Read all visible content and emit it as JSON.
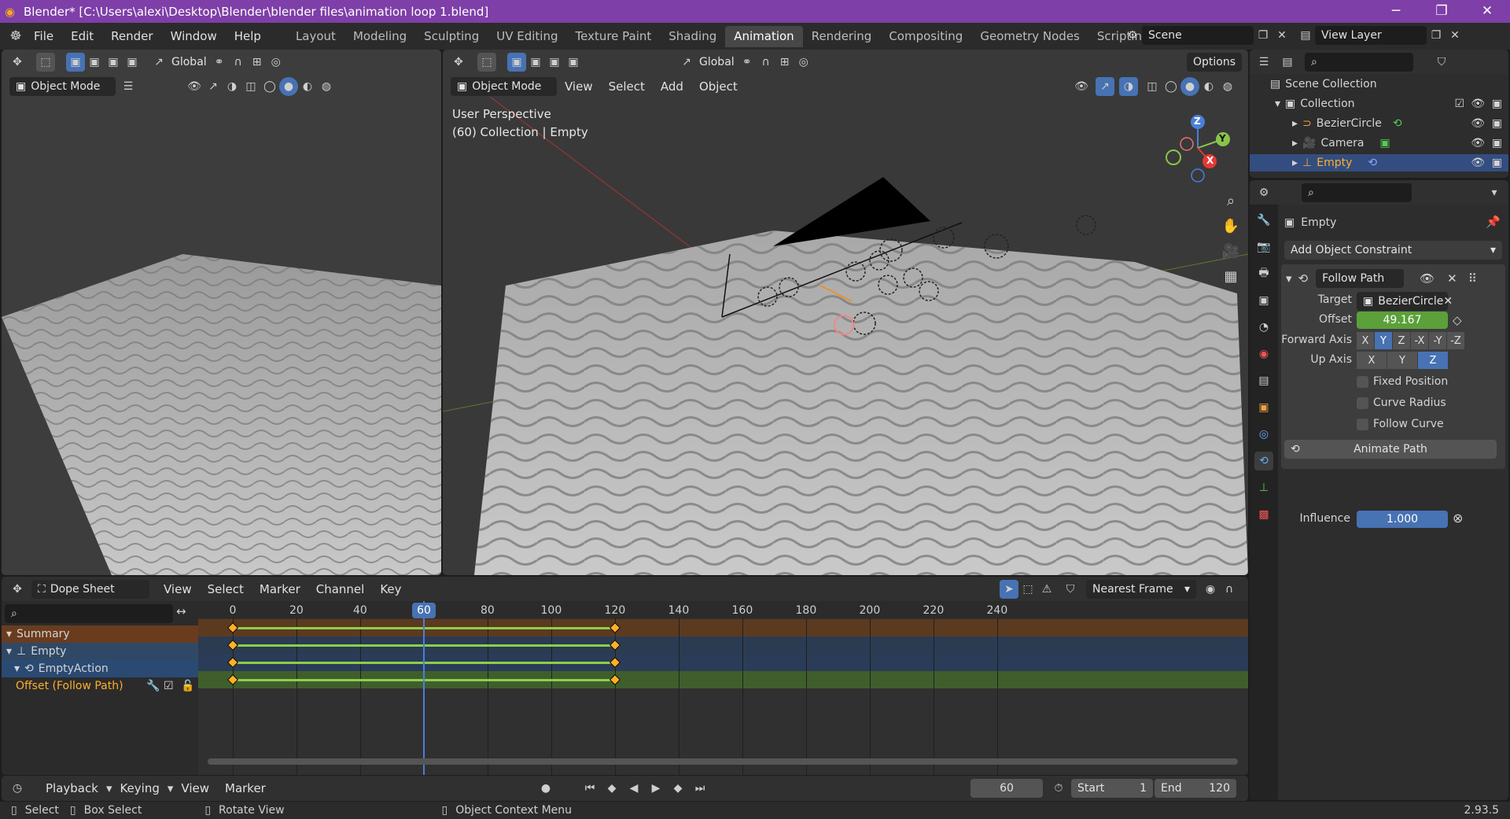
{
  "window": {
    "title": "Blender* [C:\\Users\\alexi\\Desktop\\Blender\\blender files\\animation loop 1.blend]",
    "minimize": "─",
    "maximize": "❐",
    "close": "✕"
  },
  "menu": [
    "File",
    "Edit",
    "Render",
    "Window",
    "Help"
  ],
  "workspaces": [
    "Layout",
    "Modeling",
    "Sculpting",
    "UV Editing",
    "Texture Paint",
    "Shading",
    "Animation",
    "Rendering",
    "Compositing",
    "Geometry Nodes",
    "Scripting"
  ],
  "workspace_add": "+",
  "scene_name": "Scene",
  "view_layer": "View Layer",
  "left_view": {
    "orientation": "Global",
    "mode": "Object Mode"
  },
  "main_view": {
    "orientation": "Global",
    "options": "Options",
    "mode": "Object Mode",
    "menus": [
      "View",
      "Select",
      "Add",
      "Object"
    ],
    "overlay_title": "User Perspective",
    "overlay_sub": "(60) Collection | Empty",
    "gizmo": {
      "z": "Z",
      "y": "Y",
      "x": "X"
    }
  },
  "outliner": {
    "scene_collection": "Scene Collection",
    "collection": "Collection",
    "items": [
      {
        "name": "BezierCircle"
      },
      {
        "name": "Camera"
      },
      {
        "name": "Empty"
      }
    ]
  },
  "properties": {
    "object_name": "Empty",
    "add_constraint": "Add Object Constraint",
    "constraint_name": "Follow Path",
    "target_label": "Target",
    "target_value": "BezierCircle",
    "offset_label": "Offset",
    "offset_value": "49.167",
    "forward_label": "Forward Axis",
    "forward_axes": [
      "X",
      "Y",
      "Z",
      "-X",
      "-Y",
      "-Z"
    ],
    "forward_selected": "Y",
    "up_label": "Up Axis",
    "up_axes": [
      "X",
      "Y",
      "Z"
    ],
    "up_selected": "Z",
    "fixed_position": "Fixed Position",
    "curve_radius": "Curve Radius",
    "follow_curve": "Follow Curve",
    "animate_path": "Animate Path",
    "influence_label": "Influence",
    "influence_value": "1.000"
  },
  "dopesheet": {
    "editor": "Dope Sheet",
    "menus": [
      "View",
      "Select",
      "Marker",
      "Channel",
      "Key"
    ],
    "snap": "Nearest Frame",
    "current_frame": "60",
    "ticks": [
      "0",
      "20",
      "40",
      "60",
      "80",
      "100",
      "120",
      "140",
      "160",
      "180",
      "200",
      "220",
      "240"
    ],
    "channels": [
      {
        "label": "Summary",
        "kind": "summary"
      },
      {
        "label": "Empty",
        "kind": "object"
      },
      {
        "label": "EmptyAction",
        "kind": "action"
      },
      {
        "label": "Offset (Follow Path)",
        "kind": "fcurve"
      }
    ],
    "keyframes": [
      0,
      120
    ]
  },
  "timeline": {
    "menus": [
      "Playback",
      "Keying",
      "View",
      "Marker"
    ],
    "frame": "60",
    "start_label": "Start",
    "start_value": "1",
    "end_label": "End",
    "end_value": "120"
  },
  "statusbar": {
    "select": "Select",
    "box_select": "Box Select",
    "rotate": "Rotate View",
    "context": "Object Context Menu",
    "version": "2.93.5"
  }
}
